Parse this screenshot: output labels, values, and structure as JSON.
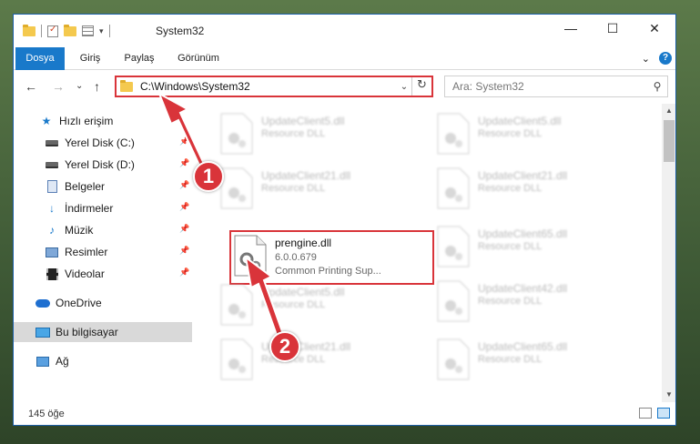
{
  "window": {
    "title": "System32",
    "controls": {
      "minimize": "—",
      "maximize": "☐",
      "close": "✕"
    }
  },
  "ribbon": {
    "tabs": [
      "Dosya",
      "Giriş",
      "Paylaş",
      "Görünüm"
    ],
    "expand_glyph": "⌄",
    "help_glyph": "?"
  },
  "navigation": {
    "back_glyph": "←",
    "forward_glyph": "→",
    "recent_glyph": "⌄",
    "up_glyph": "↑",
    "address": "C:\\Windows\\System32",
    "address_dropdown_glyph": "⌄",
    "refresh_glyph": "↻",
    "search_placeholder": "Ara: System32",
    "search_glyph": "⚲"
  },
  "sidebar": {
    "items": [
      {
        "label": "Hızlı erişim",
        "icon": "star-icon",
        "pinned": false
      },
      {
        "label": "Yerel Disk (C:)",
        "icon": "disk-icon",
        "pinned": true
      },
      {
        "label": "Yerel Disk (D:)",
        "icon": "disk-icon",
        "pinned": true
      },
      {
        "label": "Belgeler",
        "icon": "document-icon",
        "pinned": true
      },
      {
        "label": "İndirmeler",
        "icon": "download-icon",
        "pinned": true
      },
      {
        "label": "Müzik",
        "icon": "music-icon",
        "pinned": true
      },
      {
        "label": "Resimler",
        "icon": "picture-icon",
        "pinned": true
      },
      {
        "label": "Videolar",
        "icon": "video-icon",
        "pinned": true
      },
      {
        "label": "OneDrive",
        "icon": "cloud-icon",
        "pinned": false
      },
      {
        "label": "Bu bilgisayar",
        "icon": "computer-icon",
        "pinned": false,
        "selected": true
      },
      {
        "label": "Ağ",
        "icon": "network-icon",
        "pinned": false
      }
    ]
  },
  "files": [
    {
      "name": "UpdateClient5.dll",
      "type": "Resource DLL"
    },
    {
      "name": "UpdateClient5.dll",
      "type": "Resource DLL"
    },
    {
      "name": "UpdateClient21.dll",
      "type": "Resource DLL"
    },
    {
      "name": "UpdateClient21.dll",
      "type": "Resource DLL"
    },
    {
      "name": "prengine.dll",
      "type": "6.0.0.679",
      "description": "Common Printing Sup...",
      "highlighted": true
    },
    {
      "name": "UpdateClient65.dll",
      "type": "Resource DLL"
    },
    {
      "name": "UpdateClient5.dll",
      "type": "Resource DLL"
    },
    {
      "name": "UpdateClient42.dll",
      "type": "Resource DLL"
    },
    {
      "name": "UpdateClient21.dll",
      "type": "Resource DLL"
    },
    {
      "name": "UpdateClient65.dll",
      "type": "Resource DLL"
    }
  ],
  "status": {
    "count": "145 öğe"
  },
  "annotations": {
    "step1": "1",
    "step2": "2"
  },
  "colors": {
    "accent": "#1979ca",
    "highlight": "#d9343a",
    "folder": "#f4c94e"
  }
}
